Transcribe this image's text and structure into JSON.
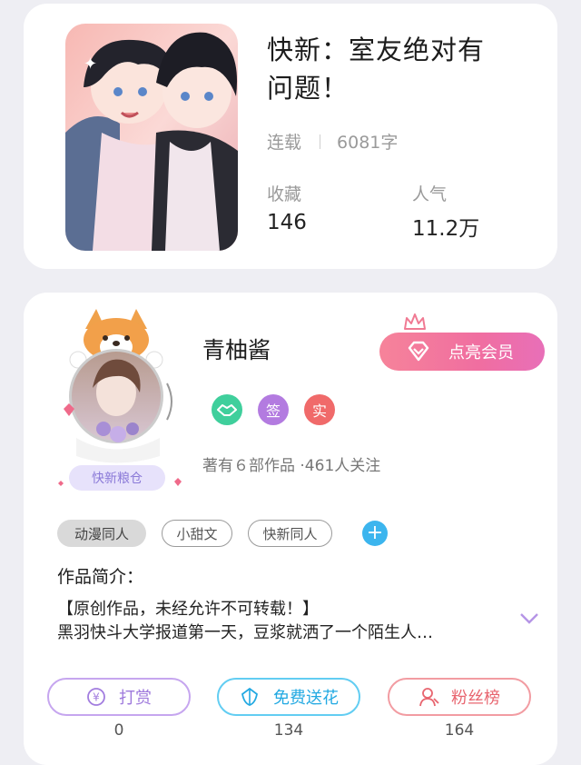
{
  "book": {
    "title_line1": "快新：室友绝对有",
    "title_line2": "问题！",
    "status": "连载",
    "word_count": "6081字",
    "favorites_label": "收藏",
    "favorites_value": "146",
    "popularity_label": "人气",
    "popularity_value": "11.2万"
  },
  "author": {
    "name": "青柚酱",
    "avatar_caption": "快新粮仓",
    "vip_button": "点亮会员",
    "badges": [
      {
        "icon": "handshake-icon",
        "text": "",
        "color": "#3fcf9c"
      },
      {
        "icon": "sign-icon",
        "text": "签",
        "color": "#b37be0"
      },
      {
        "icon": "verified-icon",
        "text": "实",
        "color": "#f06a6a"
      }
    ],
    "works_info": "著有６部作品 ·461人关注"
  },
  "tags": [
    "动漫同人",
    "小甜文",
    "快新同人"
  ],
  "intro": {
    "heading": "作品简介：",
    "line1": "【原创作品，未经允许不可转载！】",
    "line2": "黑羽快斗大学报道第一天，豆浆就洒了一个陌生人…"
  },
  "actions": [
    {
      "label": "打赏",
      "count": "0",
      "icon": "yen-icon",
      "color": "#b58ce6"
    },
    {
      "label": "免费送花",
      "count": "134",
      "icon": "flower-icon",
      "color": "#3ec4ef"
    },
    {
      "label": "粉丝榜",
      "count": "164",
      "icon": "fans-icon",
      "color": "#f07e87"
    }
  ]
}
